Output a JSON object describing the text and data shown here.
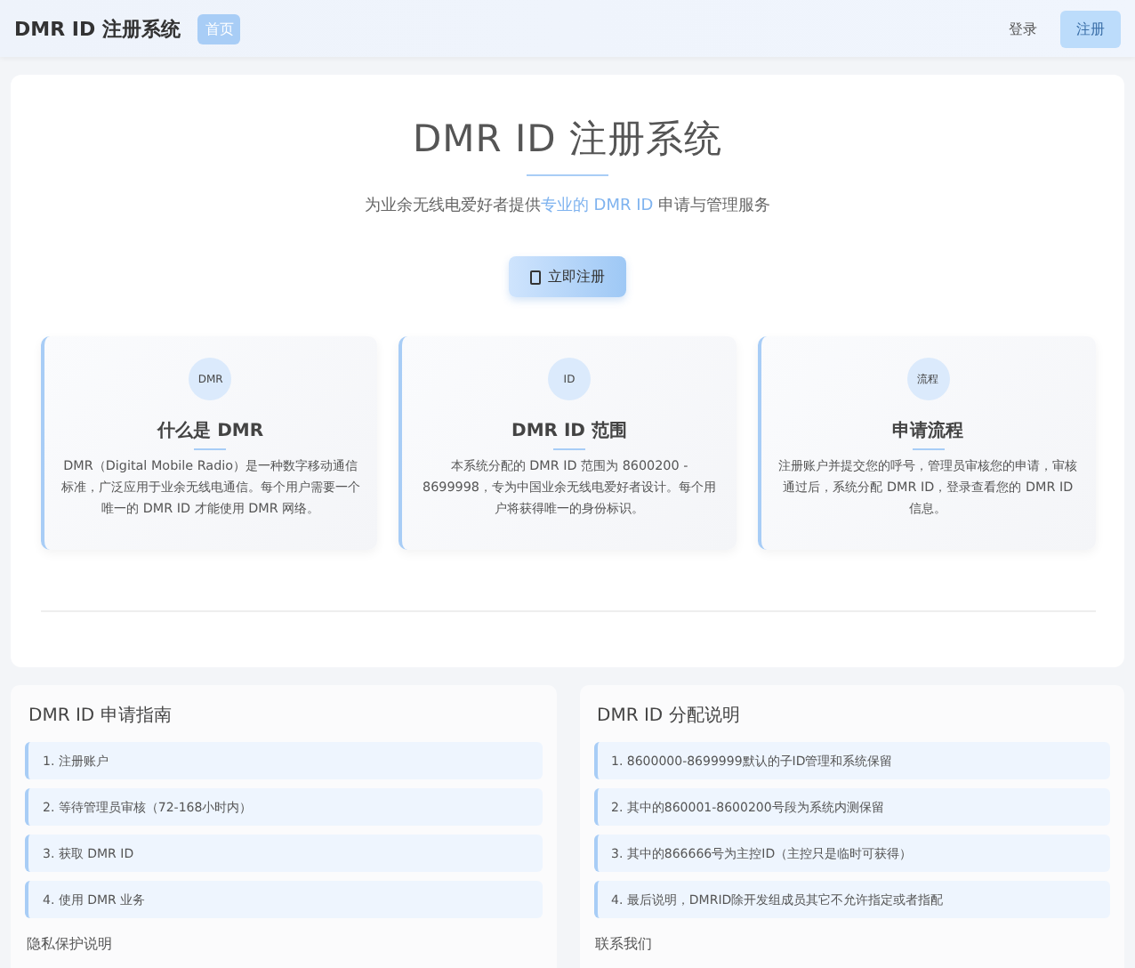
{
  "header": {
    "brand": "DMR ID 注册系统",
    "nav": [
      {
        "label": "首页",
        "selected": true
      }
    ],
    "actions": [
      {
        "label": "登录",
        "kind": "plain"
      },
      {
        "label": "注册",
        "kind": "primary"
      }
    ]
  },
  "hero": {
    "title": "DMR ID 注册系统",
    "subtitle": "为业余无线电爱好者提供**专业的 DMR ID** 申请与管理服务",
    "button": "立即注册",
    "features": [
      {
        "badge": "DMR",
        "title": "什么是 DMR",
        "text": "DMR（Digital Mobile Radio）是一种数字移动通信标准，广泛应用于业余无线电通信。每个用户需要一个唯一的 DMR ID 才能使用 DMR 网络。"
      },
      {
        "badge": "ID",
        "title": "DMR ID 范围",
        "text": "本系统分配的 DMR ID 范围为 8600200 - 8699998，专为中国业余无线电爱好者设计。每个用户将获得唯一的身份标识。"
      },
      {
        "badge": "流程",
        "title": "申请流程",
        "text": "注册账户并提交您的呼号，管理员审核您的申请，审核通过后，系统分配 DMR ID，登录查看您的 DMR ID 信息。"
      }
    ]
  },
  "panels": [
    {
      "title": "DMR ID 申请指南",
      "steps": [
        "1. 注册账户",
        "2. 等待管理员审核（72-168小时内）",
        "3. 获取 DMR ID",
        "4. 使用 DMR 业务"
      ],
      "footer": "隐私保护说明"
    },
    {
      "title": "DMR ID 分配说明",
      "steps": [
        "1. 8600000-8699999默认的子ID管理和系统保留",
        "2. 其中的860001-8600200号段为系统内测保留",
        "3. 其中的866666号为主控ID（主控只是临时可获得）",
        "4. 最后说明，DMRID除开发组成员其它不允许指定或者指配"
      ],
      "footer": "联系我们"
    }
  ]
}
